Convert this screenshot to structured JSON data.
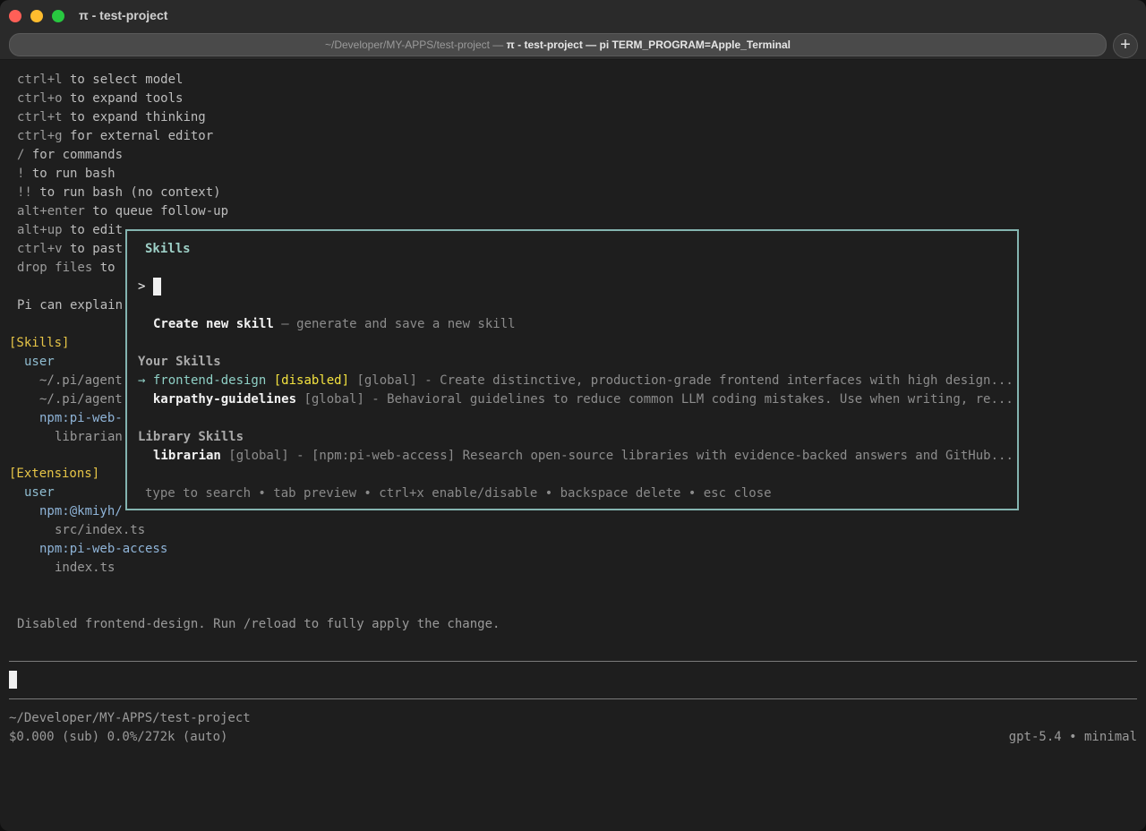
{
  "window": {
    "title": "π - test-project",
    "tab": {
      "path": "~/Developer/MY-APPS/test-project",
      "sep1": " — ",
      "name": "π - test-project",
      "sep2": " — ",
      "cmd": "pi TERM_PROGRAM=Apple_Terminal"
    },
    "new_tab": "+"
  },
  "shortcuts": [
    {
      "key": "ctrl+l",
      "desc": " to select model"
    },
    {
      "key": "ctrl+o",
      "desc": " to expand tools"
    },
    {
      "key": "ctrl+t",
      "desc": " to expand thinking"
    },
    {
      "key": "ctrl+g",
      "desc": " for external editor"
    },
    {
      "key": "/",
      "desc": " for commands"
    },
    {
      "key": "!",
      "desc": " to run bash"
    },
    {
      "key": "!!",
      "desc": " to run bash (no context)"
    },
    {
      "key": "alt+enter",
      "desc": " to queue follow-up"
    },
    {
      "key": "alt+up",
      "desc": " to edit"
    },
    {
      "key": "ctrl+v",
      "desc": " to past"
    },
    {
      "key": "drop files",
      "desc": " to"
    }
  ],
  "pi_explain": "Pi can explain",
  "skills_section": {
    "header": "[Skills]",
    "user": "user",
    "paths": [
      "~/.pi/agent",
      "~/.pi/agent",
      "npm:pi-web-"
    ],
    "librarian": "librarian"
  },
  "extensions_section": {
    "header": "[Extensions]",
    "user": "user",
    "pkg1": "npm:@kmiyh/",
    "pkg1_file": "src/index.ts",
    "pkg2": "npm:pi-web-access",
    "pkg2_file": "index.ts"
  },
  "status_message": "Disabled frontend-design. Run /reload to fully apply the change.",
  "footer": {
    "cwd": "~/Developer/MY-APPS/test-project",
    "cost": "$0.000 (sub) 0.0%/272k (auto)",
    "model": "gpt-5.4 • minimal"
  },
  "modal": {
    "title": "Skills",
    "prompt": ">",
    "create": {
      "label": "Create new skill",
      "desc": " — generate and save a new skill"
    },
    "your_skills_heading": "Your Skills",
    "your_skills": [
      {
        "arrow": "→ ",
        "name": "frontend-design",
        "status": " [disabled]",
        "scope": " [global]",
        "desc": " - Create distinctive, production-grade frontend interfaces with high design..."
      },
      {
        "arrow": "  ",
        "name": "karpathy-guidelines",
        "status": "",
        "scope": " [global]",
        "desc": " - Behavioral guidelines to reduce common LLM coding mistakes. Use when writing, re..."
      }
    ],
    "library_heading": "Library Skills",
    "library": [
      {
        "name": "librarian",
        "scope": " [global]",
        "source": " - [npm:pi-web-access]",
        "desc": " Research open-source libraries with evidence-backed answers and GitHub..."
      }
    ],
    "hints": "type to search • tab preview • ctrl+x enable/disable • backspace delete • esc close"
  },
  "colors": {
    "background": "#1e1e1e",
    "modal_border": "#84b4b0",
    "accent_gold": "#e7c547",
    "disabled_yellow": "#f3e23f",
    "selected_teal": "#8fd0c6"
  }
}
